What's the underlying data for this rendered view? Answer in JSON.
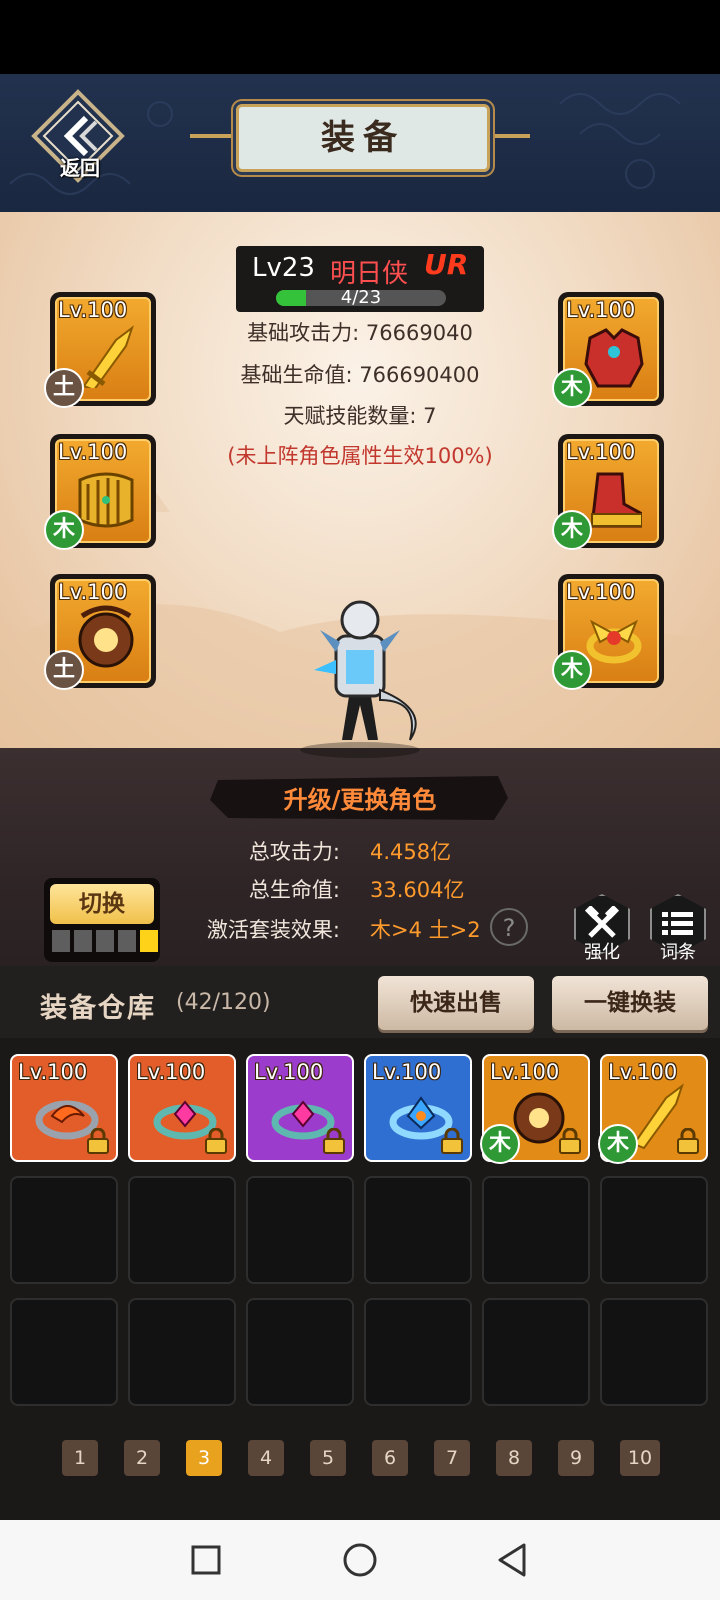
{
  "header": {
    "back_label": "返回",
    "title": "装备"
  },
  "hero": {
    "level_label": "Lv23",
    "name": "明日侠",
    "rarity": "UR",
    "xp_text": "4/23",
    "xp_fraction": 0.174,
    "stats": [
      "基础攻击力: 76669040",
      "基础生命值: 766690400",
      "天赋技能数量: 7"
    ],
    "note": "(未上阵角色属性生效100%)"
  },
  "equipment_slots": [
    {
      "id": "weapon",
      "level": "Lv.100",
      "element": "土",
      "element_type": "earth",
      "icon": "golden-sword-icon"
    },
    {
      "id": "armor",
      "level": "Lv.100",
      "element": "木",
      "element_type": "wood",
      "icon": "red-armor-icon"
    },
    {
      "id": "bracer",
      "level": "Lv.100",
      "element": "木",
      "element_type": "wood",
      "icon": "golden-bracer-icon"
    },
    {
      "id": "boots",
      "level": "Lv.100",
      "element": "木",
      "element_type": "wood",
      "icon": "golden-boots-icon"
    },
    {
      "id": "amulet",
      "level": "Lv.100",
      "element": "土",
      "element_type": "earth",
      "icon": "bronze-amulet-icon"
    },
    {
      "id": "ring",
      "level": "Lv.100",
      "element": "木",
      "element_type": "wood",
      "icon": "winged-ring-icon"
    }
  ],
  "upgrade_banner": "升级/更换角色",
  "totals": [
    {
      "label": "总攻击力:",
      "value": "4.458亿"
    },
    {
      "label": "总生命值:",
      "value": "33.604亿"
    },
    {
      "label": "激活套装效果:",
      "value": "木>4 土>2"
    }
  ],
  "help_glyph": "?",
  "switch": {
    "label": "切换",
    "segments_total": 5,
    "segment_active": 5
  },
  "tools": [
    {
      "label": "强化",
      "icon": "hammers-icon"
    },
    {
      "label": "词条",
      "icon": "list-icon"
    }
  ],
  "warehouse": {
    "title": "装备仓库",
    "count": "(42/120)",
    "quick_sell": "快速出售",
    "one_click_equip": "一键换装"
  },
  "inventory": [
    {
      "level": "Lv.100",
      "rarity_color": "#e05a2a",
      "icon": "dragon-ring-icon",
      "locked": true,
      "element": ""
    },
    {
      "level": "Lv.100",
      "rarity_color": "#e05a2a",
      "icon": "gem-ring-icon",
      "locked": true,
      "element": ""
    },
    {
      "level": "Lv.100",
      "rarity_color": "#9b39c9",
      "icon": "gem-ring-icon",
      "locked": true,
      "element": ""
    },
    {
      "level": "Lv.100",
      "rarity_color": "#2f6fd1",
      "icon": "crystal-ring-icon",
      "locked": true,
      "element": ""
    },
    {
      "level": "Lv.100",
      "rarity_color": "#e38b17",
      "icon": "bronze-amulet-icon",
      "locked": true,
      "element": "木"
    },
    {
      "level": "Lv.100",
      "rarity_color": "#e38b17",
      "icon": "golden-sword-icon",
      "locked": true,
      "element": "木"
    }
  ],
  "pagination": {
    "pages": [
      "1",
      "2",
      "3",
      "4",
      "5",
      "6",
      "7",
      "8",
      "9",
      "10"
    ],
    "current": "3"
  },
  "colors": {
    "wood": "#2f9a35",
    "earth": "#6b5344",
    "accent": "#ff9b2d"
  }
}
